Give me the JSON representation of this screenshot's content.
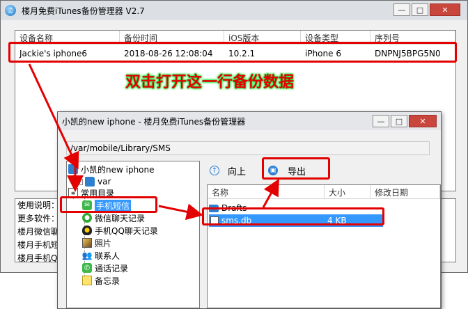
{
  "main_window": {
    "title": "楼月免费iTunes备份管理器 V2.7",
    "controls": {
      "minimize": "—",
      "maximize": "□",
      "close": "✕"
    },
    "columns": [
      "设备名称",
      "备份时间",
      "iOS版本",
      "设备类型",
      "序列号"
    ],
    "rows": [
      {
        "name": "Jackie's iphone6",
        "time": "2018-08-26 12:08:04",
        "ios": "10.2.1",
        "type": "iPhone 6",
        "serial": "DNPNJ5BPG5N0"
      }
    ],
    "log_lines": [
      "使用说明：",
      "更多软件：",
      "楼月微信聊",
      "楼月手机短",
      "楼月手机QQ"
    ]
  },
  "annotation": {
    "text": "双击打开这一行备份数据"
  },
  "sub_window": {
    "title": "小凯的new iphone - 楼月免费iTunes备份管理器",
    "controls": {
      "minimize": "—",
      "maximize": "□",
      "close": "✕"
    },
    "path": "/var/mobile/Library/SMS",
    "toolbar": {
      "up_label": "向上",
      "export_label": "导出"
    },
    "tree": {
      "root": "小凯的new iphone",
      "var": "var",
      "common": "常用目录",
      "items": [
        "手机短信",
        "微信聊天记录",
        "手机QQ聊天记录",
        "照片",
        "联系人",
        "通话记录",
        "备忘录"
      ]
    },
    "file_columns": [
      "名称",
      "大小",
      "修改日期"
    ],
    "files": [
      {
        "name": "Drafts",
        "size": "",
        "date": ""
      },
      {
        "name": "sms.db",
        "size": "4 KB",
        "date": ""
      }
    ]
  },
  "colors": {
    "annotation_red": "#e30000",
    "annotation_glow": "#19e63a",
    "selection_blue": "#3399ff"
  }
}
